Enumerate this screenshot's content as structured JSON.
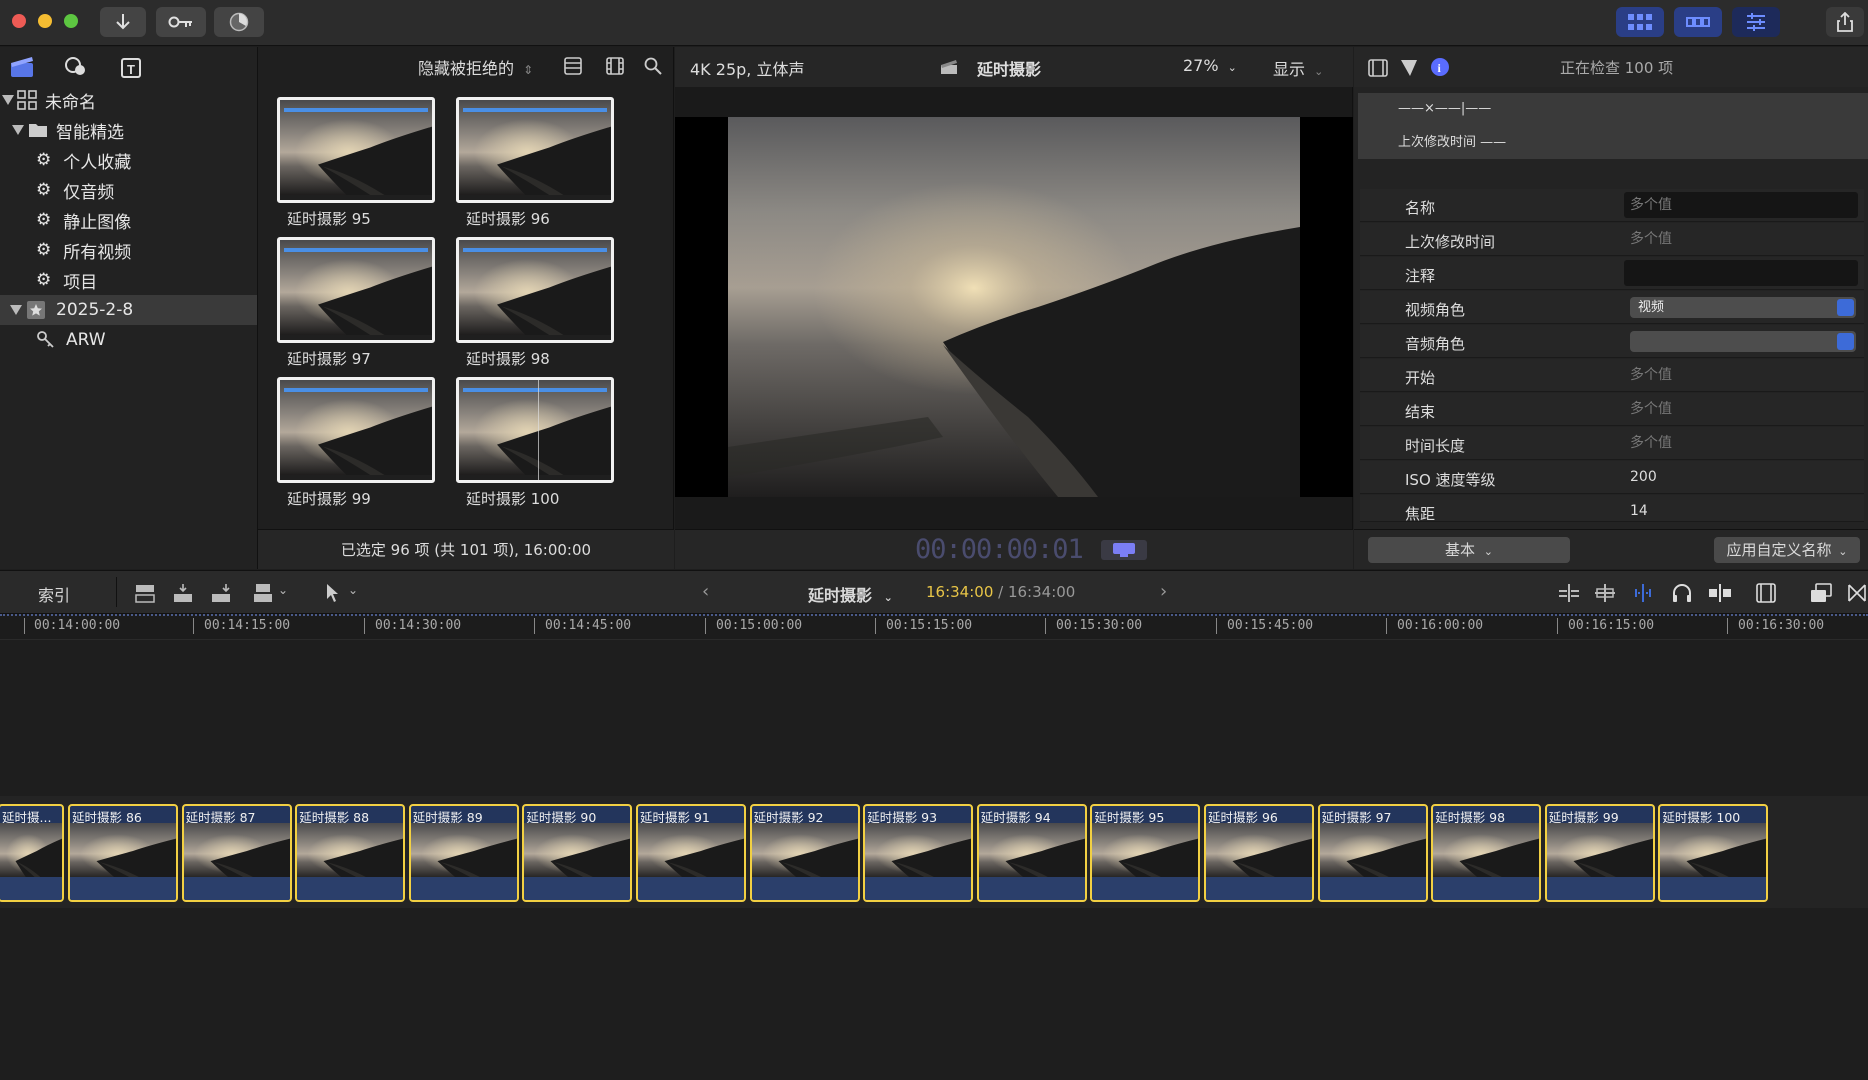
{
  "colors": {
    "accent_blue": "#4a8fe6",
    "selection_yellow": "#f2d043",
    "timecode_yellow": "#e8c547",
    "toggle_blue": "#3d6bd8"
  },
  "toolbar": {
    "import_icon": "down-arrow-icon",
    "keyword_icon": "key-icon",
    "background_tasks_icon": "progress-circle-icon",
    "share_icon": "share-icon"
  },
  "sidebar": {
    "items": [
      {
        "label": "未命名",
        "icon": "library-grid-icon",
        "level": 0
      },
      {
        "label": "智能精选",
        "icon": "folder-icon",
        "level": 0
      },
      {
        "label": "个人收藏",
        "icon": "gear-icon",
        "level": 1
      },
      {
        "label": "仅音频",
        "icon": "gear-icon",
        "level": 1
      },
      {
        "label": "静止图像",
        "icon": "gear-icon",
        "level": 1
      },
      {
        "label": "所有视频",
        "icon": "gear-icon",
        "level": 1
      },
      {
        "label": "项目",
        "icon": "gear-icon",
        "level": 1
      },
      {
        "label": "2025-2-8",
        "icon": "event-star-icon",
        "level": 0
      },
      {
        "label": "ARW",
        "icon": "keyword-icon",
        "level": 1
      }
    ]
  },
  "browser": {
    "filter_label": "隐藏被拒绝的",
    "clips": [
      {
        "label": "延时摄影 95"
      },
      {
        "label": "延时摄影 96"
      },
      {
        "label": "延时摄影 97"
      },
      {
        "label": "延时摄影 98"
      },
      {
        "label": "延时摄影 99"
      },
      {
        "label": "延时摄影 100"
      }
    ],
    "status": "已选定 96 项 (共 101 项), 16:00:00"
  },
  "viewer": {
    "format": "4K 25p, 立体声",
    "title": "延时摄影",
    "zoom": "27%",
    "display_label": "显示",
    "timecode": "00:00:00:01"
  },
  "inspector": {
    "status": "正在检查 100 项",
    "summary_line1": "——×——|——",
    "summary_line2": "上次修改时间 ——",
    "rows": [
      {
        "label": "名称",
        "value": "多个值"
      },
      {
        "label": "上次修改时间",
        "value": "多个值"
      },
      {
        "label": "注释",
        "value": ""
      },
      {
        "label": "视频角色",
        "value": "视频"
      },
      {
        "label": "音频角色",
        "value": ""
      },
      {
        "label": "开始",
        "value": "多个值"
      },
      {
        "label": "结束",
        "value": "多个值"
      },
      {
        "label": "时间长度",
        "value": "多个值"
      },
      {
        "label": "ISO 速度等级",
        "value": "200"
      },
      {
        "label": "焦距",
        "value": "14"
      }
    ],
    "metadata_view": "基本",
    "apply_names": "应用自定义名称"
  },
  "timeline_toolbar": {
    "index_label": "索引",
    "project_name": "延时摄影",
    "timecode_current": "16:34:00",
    "timecode_separator": " / ",
    "timecode_total": "16:34:00"
  },
  "ruler": {
    "ticks": [
      "00:14:00:00",
      "00:14:15:00",
      "00:14:30:00",
      "00:14:45:00",
      "00:15:00:00",
      "00:15:15:00",
      "00:15:30:00",
      "00:15:45:00",
      "00:16:00:00",
      "00:16:15:00",
      "00:16:30:00"
    ]
  },
  "timeline": {
    "clips": [
      "延时摄...",
      "延时摄影 86",
      "延时摄影 87",
      "延时摄影 88",
      "延时摄影 89",
      "延时摄影 90",
      "延时摄影 91",
      "延时摄影 92",
      "延时摄影 93",
      "延时摄影 94",
      "延时摄影 95",
      "延时摄影 96",
      "延时摄影 97",
      "延时摄影 98",
      "延时摄影 99",
      "延时摄影 100"
    ]
  }
}
